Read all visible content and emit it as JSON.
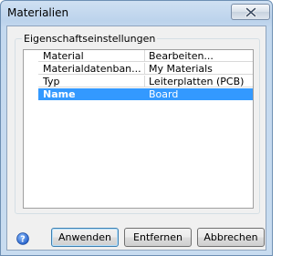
{
  "window": {
    "title": "Materialien"
  },
  "group": {
    "title": "Eigenschaftseinstellungen"
  },
  "properties": [
    {
      "name": "Material",
      "value": "Bearbeiten..."
    },
    {
      "name": "Materialdatenban...",
      "value": "My Materials"
    },
    {
      "name": "Typ",
      "value": "Leiterplatten (PCB)"
    },
    {
      "name": "Name",
      "value": "Board"
    }
  ],
  "buttons": {
    "apply": "Anwenden",
    "remove": "Entfernen",
    "cancel": "Abbrechen"
  },
  "colors": {
    "selection": "#3399ff",
    "help_icon": "#2f6fd0"
  }
}
